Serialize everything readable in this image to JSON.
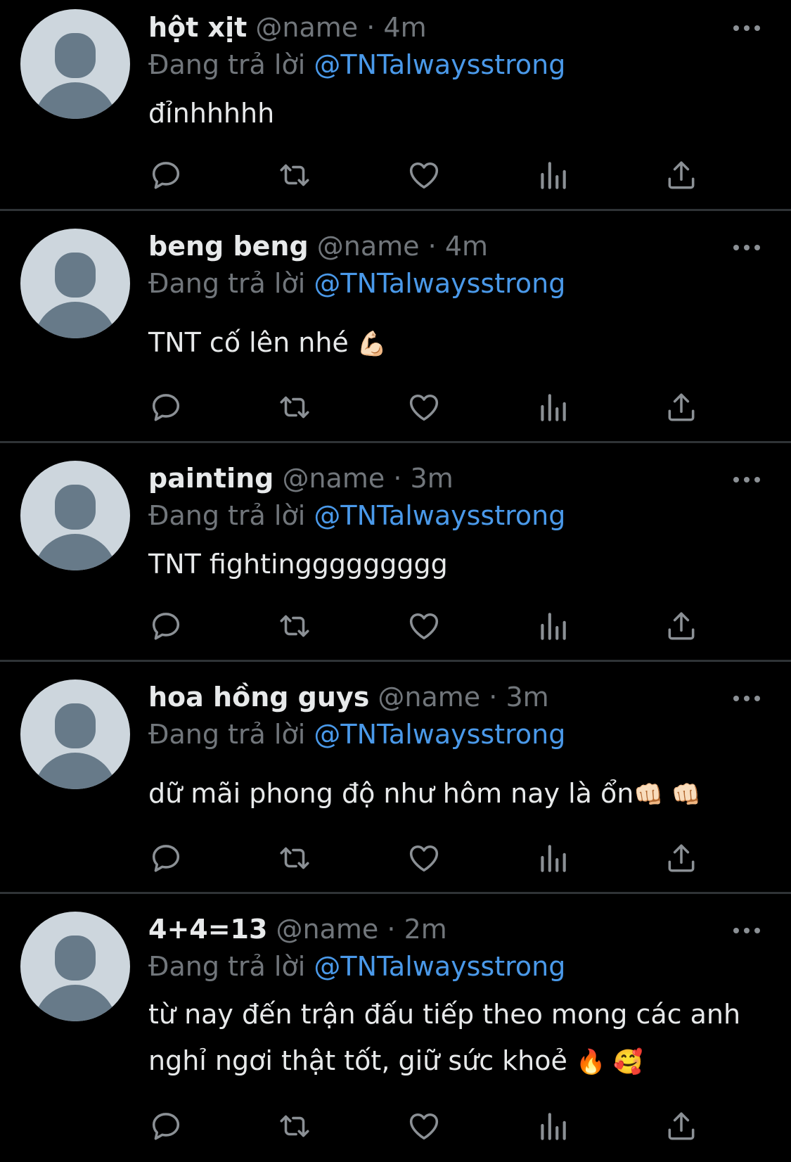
{
  "feed": {
    "reply_prefix": "Đang trả lời",
    "tweets": [
      {
        "name": "hột xịt",
        "handle": "@name",
        "separator": "·",
        "time": "4m",
        "mention": "@TNTalwaysstrong",
        "text": "đỉnhhhhh",
        "emoji": ""
      },
      {
        "name": "beng beng",
        "handle": "@name",
        "separator": "·",
        "time": "4m",
        "mention": "@TNTalwaysstrong",
        "text": "TNT cố lên nhé ",
        "emoji": "💪🏻"
      },
      {
        "name": "painting",
        "handle": "@name",
        "separator": "·",
        "time": "3m",
        "mention": "@TNTalwaysstrong",
        "text": "TNT fightinggggggggg",
        "emoji": ""
      },
      {
        "name": "hoa hồng guys",
        "handle": "@name",
        "separator": "·",
        "time": "3m",
        "mention": "@TNTalwaysstrong",
        "text": "dữ mãi phong độ như hôm nay là ổn",
        "emoji": "👊🏻 👊🏻"
      },
      {
        "name": "4+4=13",
        "handle": "@name",
        "separator": "·",
        "time": "2m",
        "mention": "@TNTalwaysstrong",
        "text": "từ nay đến trận đấu tiếp theo mong các anh nghỉ ngơi thật tốt, giữ sức khoẻ ",
        "emoji": "🔥 🥰"
      }
    ]
  },
  "icons": {
    "avatar": "default-avatar-icon",
    "more": "more-horizontal-icon",
    "reply": "reply-icon",
    "retweet": "retweet-icon",
    "like": "heart-icon",
    "views": "views-bar-chart-icon",
    "share": "share-icon"
  },
  "colors": {
    "background": "#000000",
    "primary_text": "#e7e9ea",
    "secondary_text": "#71767b",
    "link": "#4a99e9",
    "divider": "#2f3336",
    "icon": "#8b9095",
    "avatar_bg": "#cdd6dd",
    "avatar_fg": "#677a89"
  }
}
